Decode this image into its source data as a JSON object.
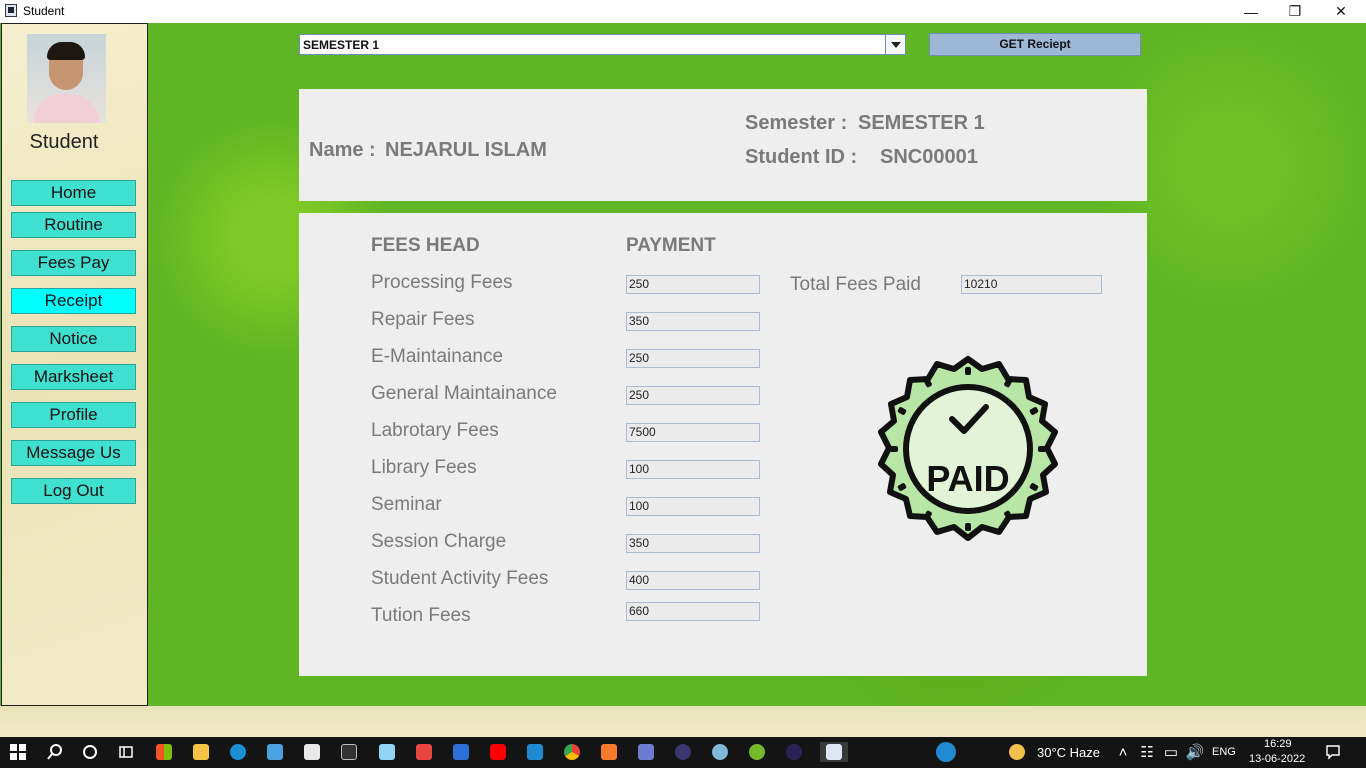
{
  "window": {
    "title": "Student"
  },
  "sidebar": {
    "title": "Student",
    "items": [
      {
        "label": "Home"
      },
      {
        "label": "Routine"
      },
      {
        "label": "Fees Pay"
      },
      {
        "label": "Receipt",
        "active": true
      },
      {
        "label": "Notice"
      },
      {
        "label": "Marksheet"
      },
      {
        "label": "Profile"
      },
      {
        "label": "Message Us"
      },
      {
        "label": "Log Out"
      }
    ]
  },
  "toolbar": {
    "semester_value": "SEMESTER 1",
    "receipt_button": "GET Reciept"
  },
  "info": {
    "name_label": "Name :",
    "name_value": "NEJARUL ISLAM",
    "semester_label": "Semester :",
    "semester_value": "SEMESTER 1",
    "student_id_label": "Student ID :",
    "student_id_value": "SNC00001"
  },
  "fees": {
    "head_label": "FEES HEAD",
    "payment_label": "PAYMENT",
    "rows": [
      {
        "label": "Processing Fees",
        "value": "250"
      },
      {
        "label": "Repair Fees",
        "value": "350"
      },
      {
        "label": "E-Maintainance",
        "value": "250"
      },
      {
        "label": "General Maintainance",
        "value": "250"
      },
      {
        "label": "Labrotary Fees",
        "value": "7500"
      },
      {
        "label": "Library Fees",
        "value": "100"
      },
      {
        "label": "Seminar",
        "value": "100"
      },
      {
        "label": "Session Charge",
        "value": "350"
      },
      {
        "label": "Student Activity Fees",
        "value": "400"
      },
      {
        "label": "Tution Fees",
        "value": "660"
      }
    ],
    "total_label": "Total Fees Paid",
    "total_value": "10210",
    "badge_text": "PAID"
  },
  "taskbar": {
    "weather": "30°C  Haze",
    "language": "ENG",
    "time": "16:29",
    "date": "13-06-2022"
  },
  "colors": {
    "nav_button": "#40e0d0",
    "nav_active": "#00ffff",
    "badge_green": "#b8e6a6"
  }
}
